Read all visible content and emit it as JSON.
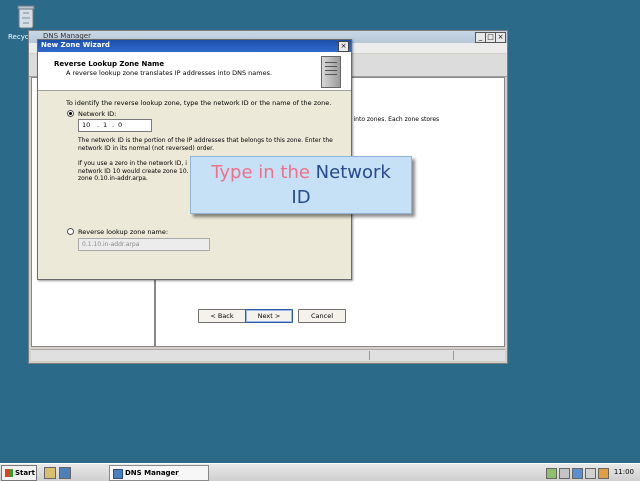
{
  "desktop": {
    "recycle_label": "Recycle"
  },
  "dns_window": {
    "title": "DNS Manager",
    "min_label": "_",
    "max_label": "□",
    "close_label": "×",
    "right_pane_text": "e divided into zones. Each zone stores"
  },
  "wizard": {
    "title": "New Zone Wizard",
    "close_label": "×",
    "heading": "Reverse Lookup Zone Name",
    "subheading": "A reverse lookup zone translates IP addresses into DNS names.",
    "intro": "To identify the reverse lookup zone, type the network ID or the name of the zone.",
    "network_id": {
      "label": "Network ID:",
      "octet1": "10",
      "dot1": ".",
      "octet2": "1",
      "dot2": ".",
      "octet3": "0",
      "selected": true
    },
    "para1": [
      "The network ID is the portion of the IP addresses that belongs to this zone. Enter the",
      "network ID in its normal (not reversed) order."
    ],
    "para2": [
      "If you use a zero in the network ID, i",
      "network ID 10 would create zone 10.",
      "zone 0.10.in-addr.arpa."
    ],
    "reverse_zone": {
      "label": "Reverse lookup zone name:",
      "value": "0.1.10.in-addr.arpa",
      "selected": false
    },
    "buttons": {
      "back": "< Back",
      "next": "Next >",
      "cancel": "Cancel"
    }
  },
  "callout": {
    "part1": "Type in the ",
    "part2": "Network",
    "part3": "ID"
  },
  "taskbar": {
    "start_label": "Start",
    "task_label": "DNS Manager",
    "clock": "11:00"
  },
  "colors": {
    "desktop": "#2b6a88",
    "wizard_title": "#1c4fa8",
    "callout_bg": "#c6e0f5",
    "callout_pink": "#f0708a",
    "callout_blue": "#284a8e"
  }
}
